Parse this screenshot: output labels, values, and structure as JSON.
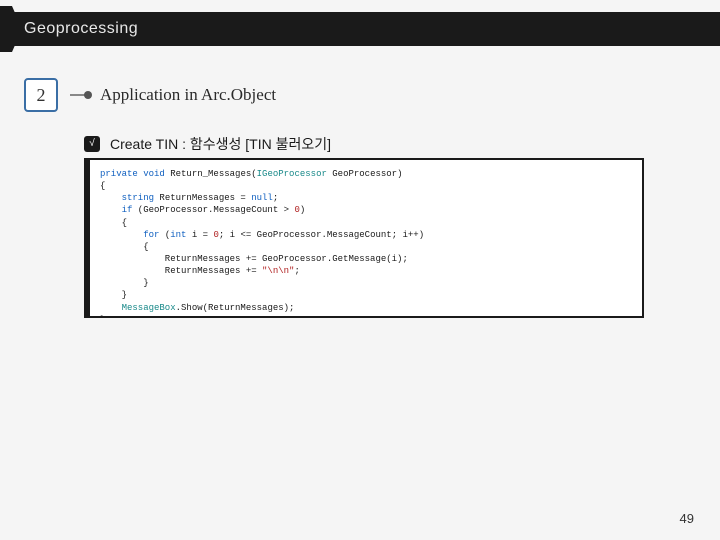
{
  "titlebar": {
    "text": "Geoprocessing"
  },
  "section": {
    "number": "2",
    "heading": "Application in Arc.Object"
  },
  "subheading": {
    "check": "√",
    "text": "Create TIN : 함수생성  [TIN 불러오기]"
  },
  "code": {
    "l1a": "private",
    "l1b": " void",
    "l1c": " Return_Messages(",
    "l1d": "IGeoProcessor",
    "l1e": " GeoProcessor)",
    "l2": "{",
    "l3a": "    string",
    "l3b": " ReturnMessages = ",
    "l3c": "null",
    "l3d": ";",
    "l4a": "    if",
    "l4b": " (GeoProcessor.MessageCount > ",
    "l4c": "0",
    "l4d": ")",
    "l5": "    {",
    "l6a": "        for",
    "l6b": " (",
    "l6c": "int",
    "l6d": " i = ",
    "l6e": "0",
    "l6f": "; i <= GeoProcessor.MessageCount; i++)",
    "l7": "        {",
    "l8": "            ReturnMessages += GeoProcessor.GetMessage(i);",
    "l9a": "            ReturnMessages += ",
    "l9b": "\"\\n\\n\"",
    "l9c": ";",
    "l10": "        }",
    "l11": "    }",
    "l12a": "    MessageBox",
    "l12b": ".Show(ReturnMessages);",
    "l13": "}"
  },
  "page": {
    "number": "49"
  }
}
